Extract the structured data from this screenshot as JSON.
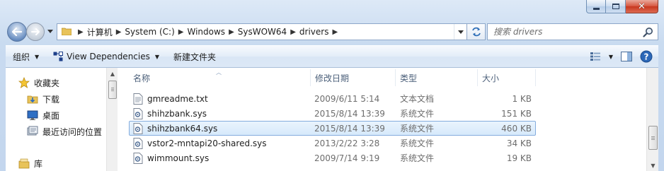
{
  "window": {
    "controls": {
      "minimize_icon": "minimize-icon",
      "maximize_icon": "maximize-icon",
      "close_icon": "close-icon"
    }
  },
  "address_bar": {
    "crumbs": [
      "计算机",
      "System (C:)",
      "Windows",
      "SysWOW64",
      "drivers"
    ]
  },
  "search": {
    "placeholder": "搜索 drivers"
  },
  "toolbar": {
    "organize": "组织",
    "view_dependencies": "View Dependencies",
    "new_folder": "新建文件夹"
  },
  "nav": {
    "favorites": "收藏夹",
    "downloads": "下载",
    "desktop": "桌面",
    "recent": "最近访问的位置",
    "libraries": "库"
  },
  "columns": {
    "name": "名称",
    "modified": "修改日期",
    "type": "类型",
    "size": "大小"
  },
  "files": [
    {
      "name": "gmreadme.txt",
      "modified": "2009/6/11 5:14",
      "type": "文本文档",
      "size": "1 KB",
      "icon": "text-file-icon"
    },
    {
      "name": "shihzbank.sys",
      "modified": "2015/8/14 13:39",
      "type": "系统文件",
      "size": "151 KB",
      "icon": "system-file-icon"
    },
    {
      "name": "shihzbank64.sys",
      "modified": "2015/8/14 13:39",
      "type": "系统文件",
      "size": "460 KB",
      "icon": "system-file-icon",
      "selected": true
    },
    {
      "name": "vstor2-mntapi20-shared.sys",
      "modified": "2013/2/22 3:28",
      "type": "系统文件",
      "size": "34 KB",
      "icon": "system-file-icon"
    },
    {
      "name": "wimmount.sys",
      "modified": "2009/7/14 9:19",
      "type": "系统文件",
      "size": "19 KB",
      "icon": "system-file-icon"
    }
  ],
  "colors": {
    "selection_fill": "#d6e9fb",
    "selection_border": "#84acdd",
    "toolbar_bg": "#dce8f6"
  }
}
